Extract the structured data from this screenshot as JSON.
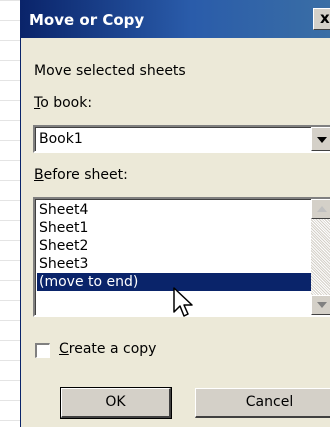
{
  "dialog": {
    "title": "Move or Copy",
    "close_glyph": "x",
    "move_label": "Move selected sheets",
    "to_book_label_u": "T",
    "to_book_label_rest": "o book:",
    "to_book_value": "Book1",
    "before_sheet_label_u": "B",
    "before_sheet_label_rest": "efore sheet:",
    "sheets": [
      "Sheet4",
      "Sheet1",
      "Sheet2",
      "Sheet3",
      "(move to end)"
    ],
    "selected_index": 4,
    "create_copy_u": "C",
    "create_copy_rest": "reate a copy",
    "create_copy_checked": false,
    "ok_label": "OK",
    "cancel_label": "Cancel"
  },
  "colors": {
    "title_bar": "#0a246a",
    "dialog_face": "#ece9d8",
    "selection": "#0a246a"
  },
  "icons": [
    "close-icon",
    "dropdown-arrow-icon",
    "scroll-up-icon",
    "scroll-down-icon",
    "mouse-pointer-icon"
  ]
}
